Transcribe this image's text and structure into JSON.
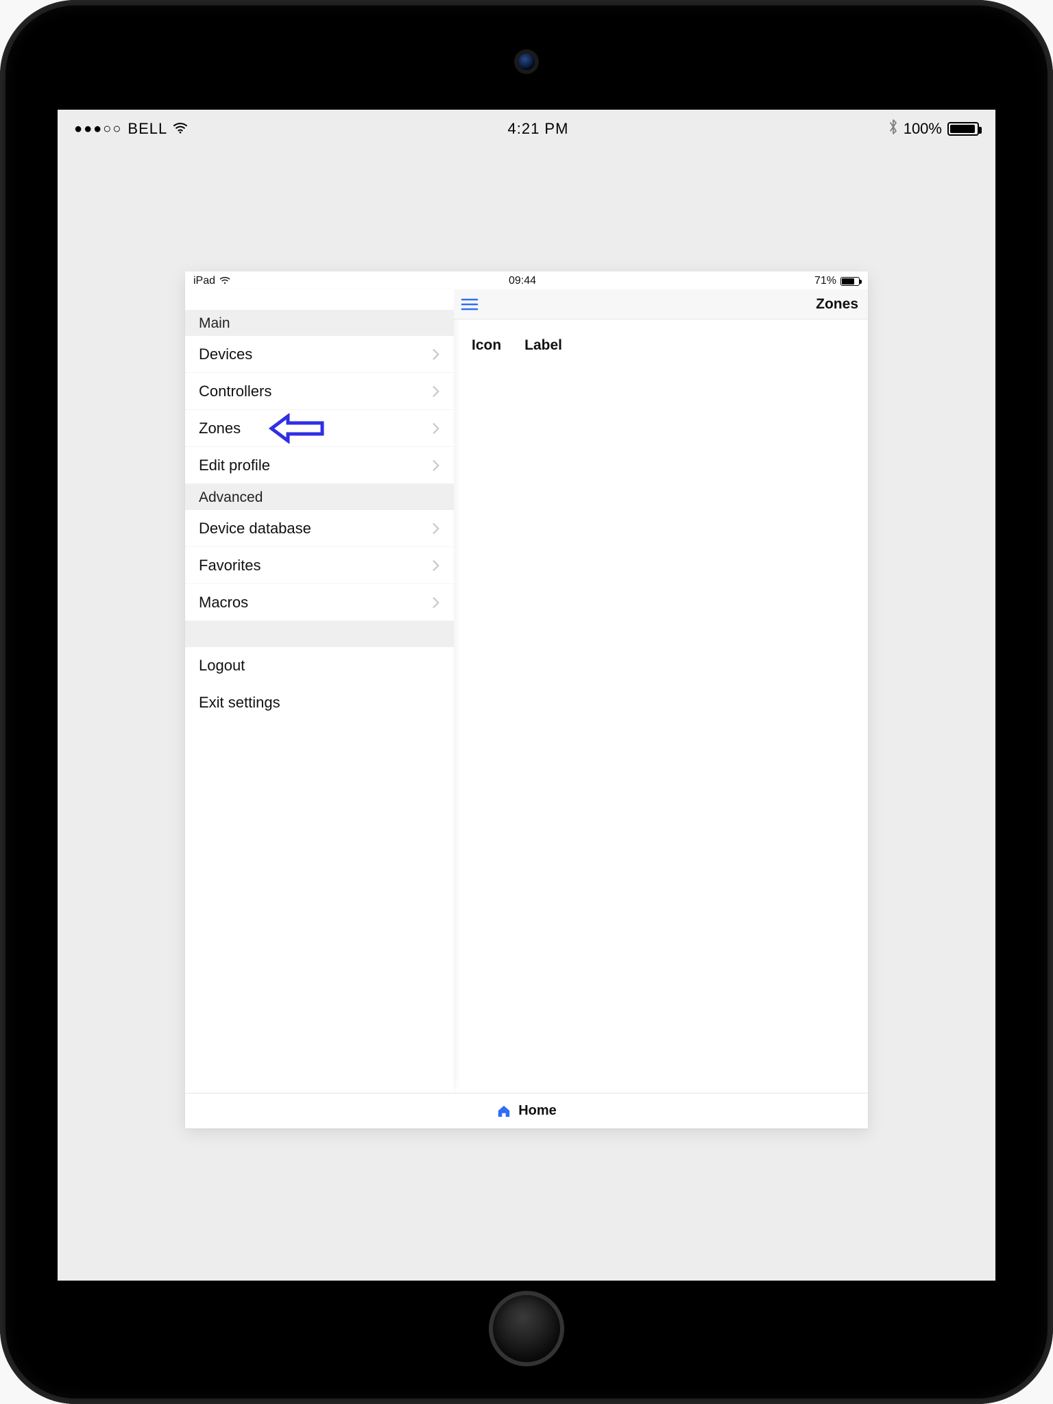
{
  "outer_status": {
    "dots": "●●●○○",
    "carrier": "BELL",
    "wifi_icon": "wifi",
    "time": "4:21 PM",
    "bluetooth_icon": "bluetooth",
    "battery_percent": "100%"
  },
  "inner_status": {
    "device": "iPad",
    "wifi_icon": "wifi",
    "time": "09:44",
    "battery_percent": "71%"
  },
  "sidebar": {
    "sections": [
      {
        "header": "Main",
        "items": [
          {
            "label": "Devices",
            "disclosure": true
          },
          {
            "label": "Controllers",
            "disclosure": true
          },
          {
            "label": "Zones",
            "disclosure": true,
            "pointer": true
          },
          {
            "label": "Edit profile",
            "disclosure": true
          }
        ]
      },
      {
        "header": "Advanced",
        "items": [
          {
            "label": "Device database",
            "disclosure": true
          },
          {
            "label": "Favorites",
            "disclosure": true
          },
          {
            "label": "Macros",
            "disclosure": true
          }
        ]
      }
    ],
    "footer_items": [
      {
        "label": "Logout"
      },
      {
        "label": "Exit settings"
      }
    ]
  },
  "detail": {
    "menu_icon": "hamburger",
    "title": "Zones",
    "column_headers": [
      "Icon",
      "Label"
    ]
  },
  "tabbar": {
    "home_icon": "home",
    "home_label": "Home"
  },
  "pointer": {
    "color": "#2f2fe6"
  }
}
